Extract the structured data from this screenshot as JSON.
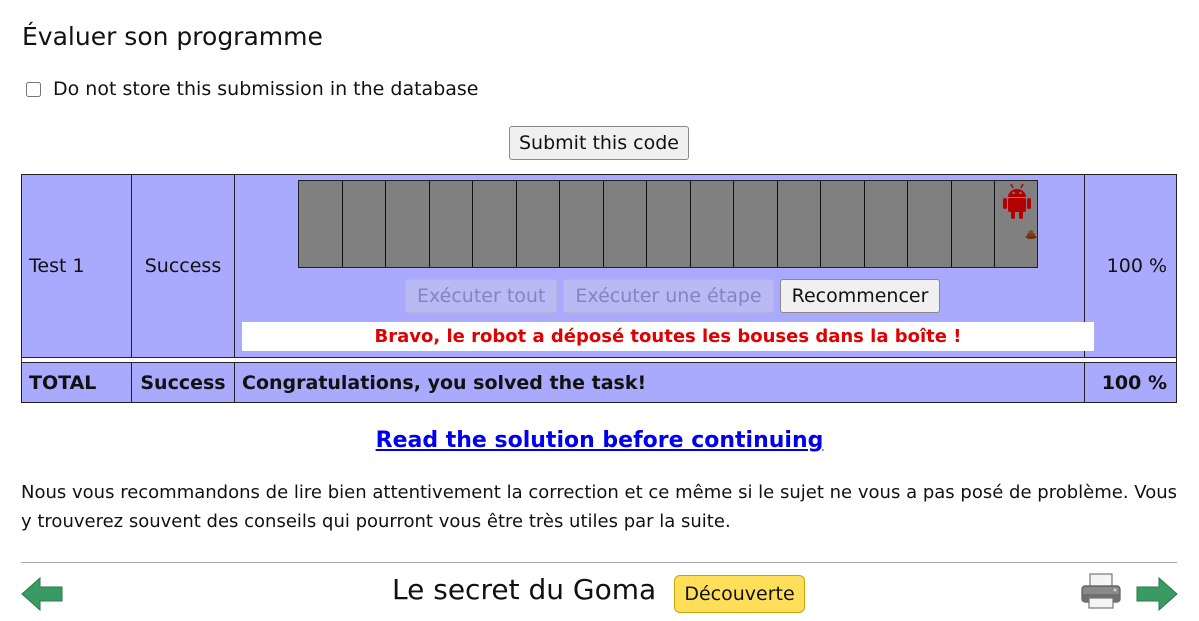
{
  "section_title": "Évaluer son programme",
  "store_checkbox": {
    "label": "Do not store this submission in the database",
    "checked": false
  },
  "submit_label": "Submit this code",
  "tests": [
    {
      "name": "Test 1",
      "status": "Success",
      "score": "100 %",
      "controls": {
        "run_all": "Exécuter tout",
        "run_step": "Exécuter une étape",
        "restart": "Recommencer"
      },
      "message": "Bravo, le robot a déposé toutes les bouses dans la boîte !"
    }
  ],
  "total": {
    "label": "TOTAL",
    "status": "Success",
    "message": "Congratulations, you solved the task!",
    "score": "100 %"
  },
  "solution_link": "Read the solution before continuing",
  "advice": "Nous vous recommandons de lire bien attentivement la correction et ce même si le sujet ne vous a pas posé de problème. Vous y trouverez souvent des conseils qui pourront vous être très utiles par la suite.",
  "footer": {
    "title": "Le secret du Goma",
    "level": "Découverte"
  },
  "colors": {
    "table_bg": "#a9a9fd",
    "grid_cell": "#808080",
    "robot": "#b30000",
    "success_msg": "#e00000",
    "badge": "#ffde59",
    "arrow": "#3a9a63",
    "link": "#0000ee"
  },
  "icons": {
    "prev": "arrow-left-icon",
    "next": "arrow-right-icon",
    "print": "printer-icon",
    "robot": "android-robot-icon",
    "dung": "dung-icon"
  }
}
